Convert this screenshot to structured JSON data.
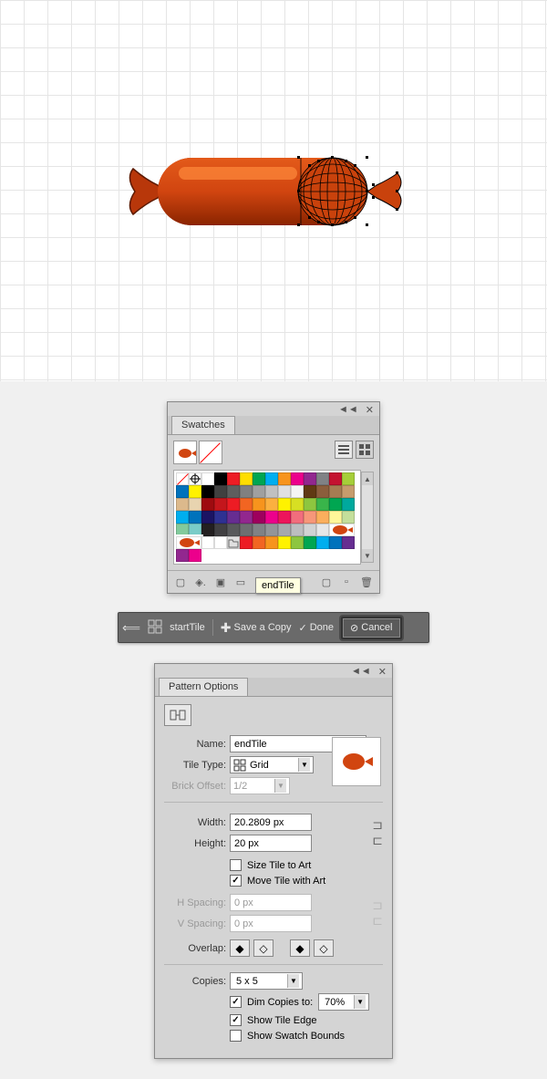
{
  "swatches_panel": {
    "title": "Swatches",
    "tooltip": "endTile",
    "grid_icon_name": "grid-view-icon",
    "list_icon_name": "list-view-icon",
    "color_rows": [
      [
        "#ffffff",
        "#000000",
        "#ed1c24",
        "#ffde00",
        "#00a651",
        "#00aeef",
        "#f7941d",
        "#ec008c",
        "#92278f",
        "#808285",
        "#c41230",
        "#a6ce39",
        "#0072bc",
        "#fff200"
      ],
      [
        "#000000",
        "#404040",
        "#5e5e5e",
        "#808080",
        "#a0a0a0",
        "#c0c0c0",
        "#e0e0e0",
        "#f5f5f5",
        "#603913",
        "#8b5e3c",
        "#a67c52",
        "#c69c6d",
        "#dcb98c",
        "#e8d4b0"
      ],
      [
        "#9e0b0f",
        "#c4161c",
        "#ed1c24",
        "#f26522",
        "#f7941d",
        "#fbb040",
        "#fff200",
        "#d7df23",
        "#8dc63f",
        "#39b54a",
        "#00a651",
        "#00a99d",
        "#00aeef",
        "#0072bc"
      ],
      [
        "#1b1464",
        "#2e3192",
        "#662d91",
        "#92278f",
        "#9e005d",
        "#ec008c",
        "#ed145b",
        "#f26d7d",
        "#f7977a",
        "#fbaf5d",
        "#fff799",
        "#c4df9b",
        "#82ca9c",
        "#7accc8"
      ]
    ],
    "gray_row": [
      "#231f20",
      "#414042",
      "#58595b",
      "#6d6e71",
      "#808285",
      "#939598",
      "#a7a9ac",
      "#bcbec0",
      "#d1d3d4",
      "#e6e7e8"
    ],
    "rainbow_row": [
      "#ed1c24",
      "#f26522",
      "#f7941d",
      "#fff200",
      "#8dc63f",
      "#00a651",
      "#00aeef",
      "#0072bc",
      "#662d91",
      "#92278f",
      "#ec008c"
    ]
  },
  "toolbar": {
    "pattern_name": "startTile",
    "save_copy": "Save a Copy",
    "done": "Done",
    "cancel": "Cancel"
  },
  "options_panel": {
    "title": "Pattern Options",
    "name_label": "Name:",
    "name_value": "endTile",
    "tile_type_label": "Tile Type:",
    "tile_type_value": "Grid",
    "brick_offset_label": "Brick Offset:",
    "brick_offset_value": "1/2",
    "width_label": "Width:",
    "width_value": "20.2809 px",
    "height_label": "Height:",
    "height_value": "20 px",
    "size_to_art": "Size Tile to Art",
    "move_with_art": "Move Tile with Art",
    "h_spacing_label": "H Spacing:",
    "h_spacing_value": "0 px",
    "v_spacing_label": "V Spacing:",
    "v_spacing_value": "0 px",
    "overlap_label": "Overlap:",
    "copies_label": "Copies:",
    "copies_value": "5 x 5",
    "dim_copies": "Dim Copies to:",
    "dim_value": "70%",
    "show_edge": "Show Tile Edge",
    "show_bounds": "Show Swatch Bounds"
  }
}
